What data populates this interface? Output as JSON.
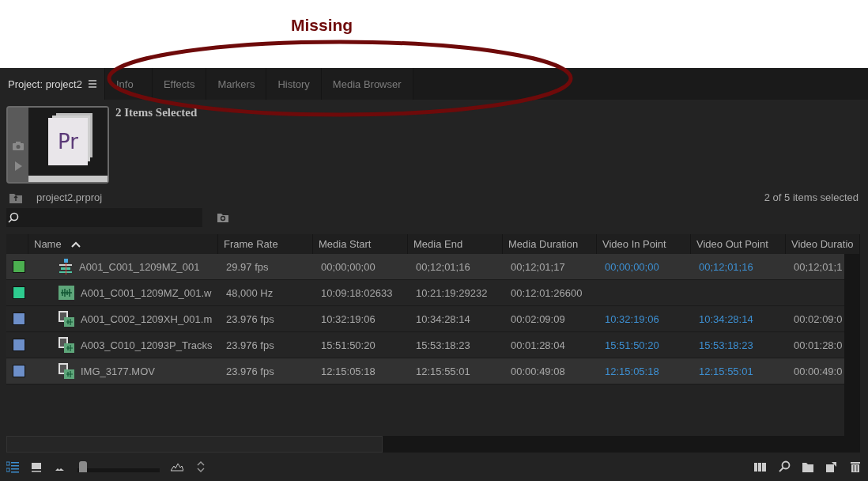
{
  "annotation": {
    "label": "Missing"
  },
  "tabs": [
    {
      "label": "Project: project2",
      "selected": true
    },
    {
      "label": "Info",
      "selected": false
    },
    {
      "label": "Effects",
      "selected": false
    },
    {
      "label": "Markers",
      "selected": false
    },
    {
      "label": "History",
      "selected": false
    },
    {
      "label": "Media Browser",
      "selected": false
    }
  ],
  "preview": {
    "logo": "Pr",
    "title": "2 Items Selected"
  },
  "project": {
    "file": "project2.prproj",
    "selection_count": "2 of 5 items selected"
  },
  "table": {
    "columns": [
      "Name",
      "Frame Rate",
      "Media Start",
      "Media End",
      "Media Duration",
      "Video In Point",
      "Video Out Point",
      "Video Duratio"
    ],
    "rows": [
      {
        "color": "#4caf50",
        "kind": "sequence",
        "selected": true,
        "cells": [
          "A001_C001_1209MZ_001",
          "29.97 fps",
          "00;00;00;00",
          "00;12;01;16",
          "00;12;01;17",
          "00;00;00;00",
          "00;12;01;16",
          "00;12;01;1"
        ]
      },
      {
        "color": "#2ecc8f",
        "kind": "audio",
        "selected": false,
        "cells": [
          "A001_C001_1209MZ_001.w",
          "48,000 Hz",
          "10:09:18:02633",
          "10:21:19:29232",
          "00:12:01:26600"
        ]
      },
      {
        "color": "#6d8fc9",
        "kind": "video",
        "selected": false,
        "cells": [
          "A001_C002_1209XH_001.m",
          "23.976 fps",
          "10:32:19:06",
          "10:34:28:14",
          "00:02:09:09",
          "10:32:19:06",
          "10:34:28:14",
          "00:02:09:0"
        ]
      },
      {
        "color": "#6d8fc9",
        "kind": "video",
        "selected": false,
        "cells": [
          "A003_C010_12093P_Tracks",
          "23.976 fps",
          "15:51:50:20",
          "15:53:18:23",
          "00:01:28:04",
          "15:51:50:20",
          "15:53:18:23",
          "00:01:28:0"
        ]
      },
      {
        "color": "#6d8fc9",
        "kind": "video",
        "selected": true,
        "cells": [
          "IMG_3177.MOV",
          "23.976 fps",
          "12:15:05:18",
          "12:15:55:01",
          "00:00:49:08",
          "12:15:05:18",
          "12:15:55:01",
          "00:00:49:0"
        ]
      }
    ]
  },
  "zoom": {
    "level": 0.02
  }
}
